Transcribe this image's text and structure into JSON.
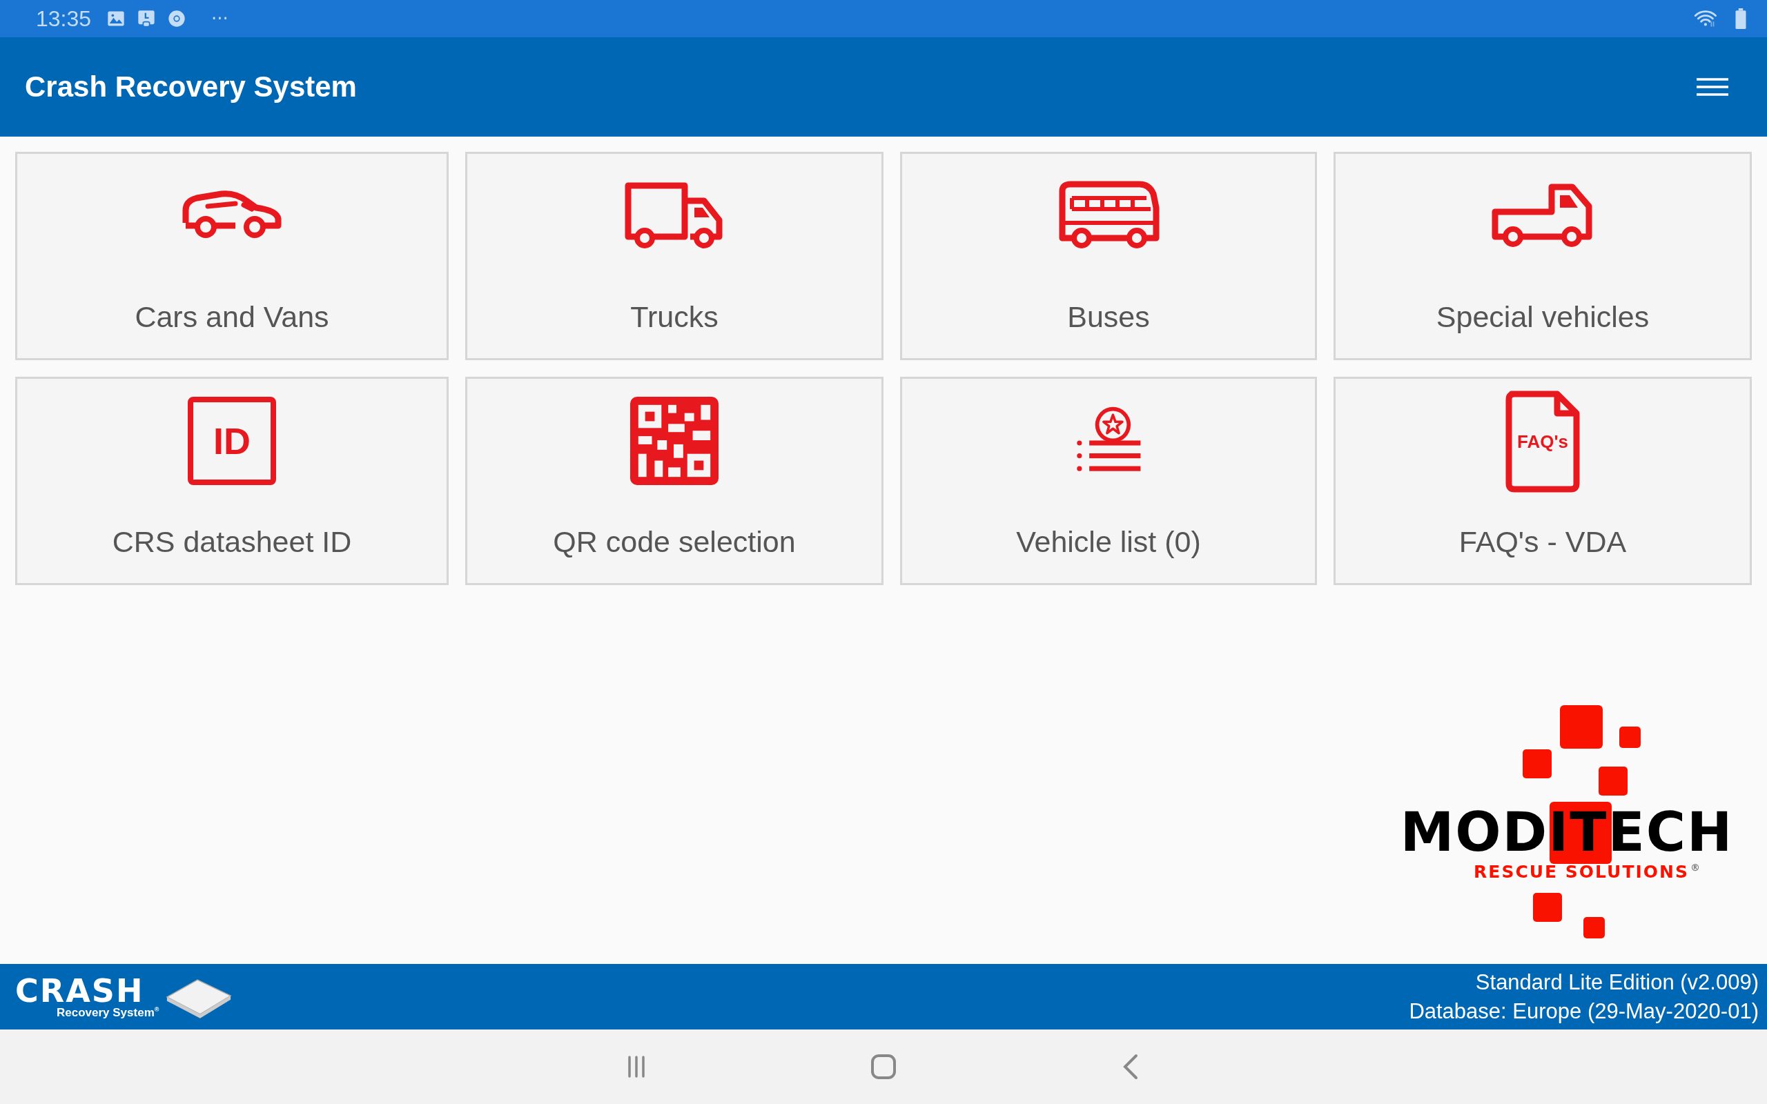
{
  "status_bar": {
    "time": "13:35",
    "more": "···"
  },
  "app_bar": {
    "title": "Crash Recovery System"
  },
  "tiles": [
    {
      "kind": "car",
      "label": "Cars and Vans"
    },
    {
      "kind": "truck",
      "label": "Trucks"
    },
    {
      "kind": "bus",
      "label": "Buses"
    },
    {
      "kind": "special",
      "label": "Special vehicles"
    },
    {
      "kind": "id",
      "icon_text": "ID",
      "label": "CRS datasheet ID"
    },
    {
      "kind": "qr",
      "label": "QR code selection"
    },
    {
      "kind": "list",
      "label": "Vehicle list (0)"
    },
    {
      "kind": "faq",
      "icon_text": "FAQ's",
      "label": "FAQ's - VDA"
    }
  ],
  "brand_logo": {
    "name": "MODITECH",
    "tagline": "RESCUE SOLUTIONS",
    "mark": "®"
  },
  "footer": {
    "logo_name": "CRASH",
    "logo_sub": "Recovery System",
    "logo_mark": "®",
    "edition": "Standard Lite Edition (v2.009)",
    "database": "Database: Europe (29-May-2020-01)"
  }
}
